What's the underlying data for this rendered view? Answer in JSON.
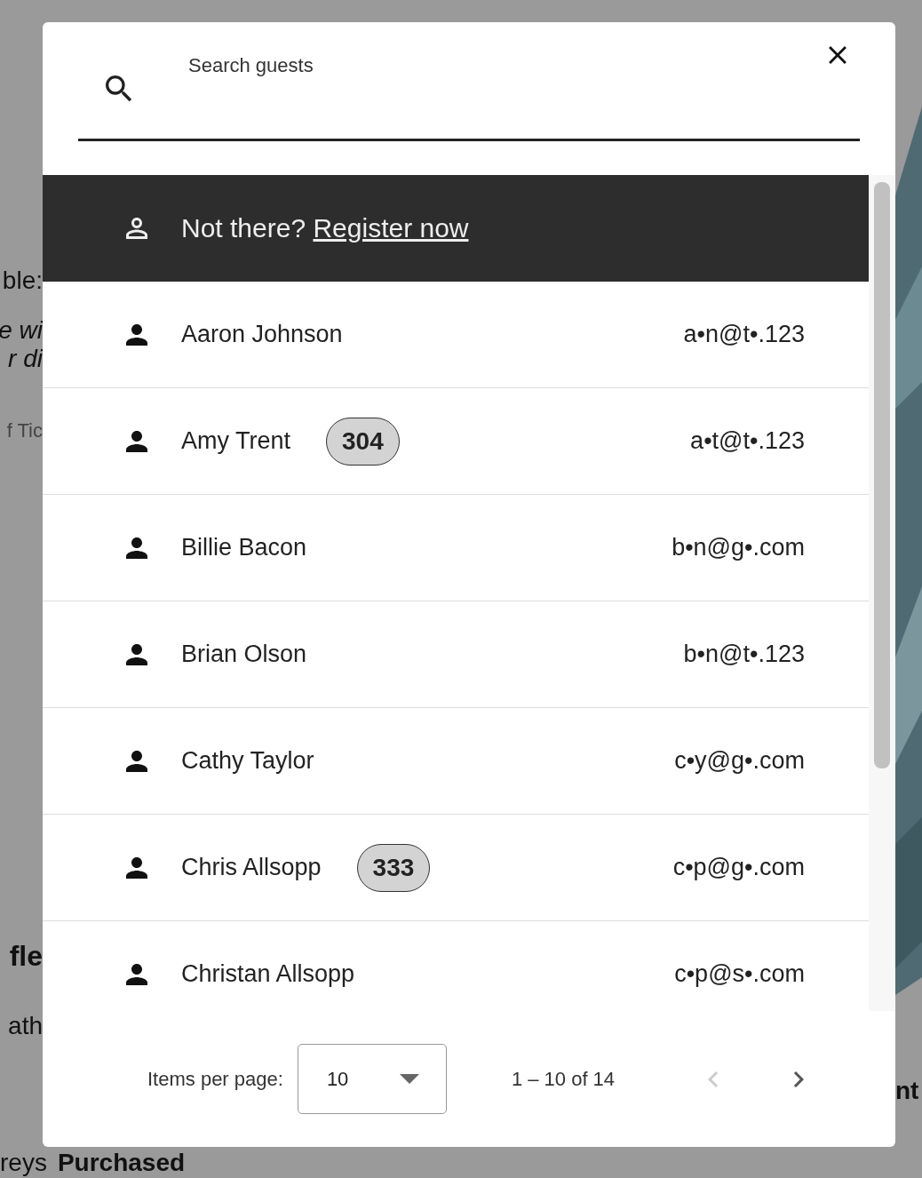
{
  "background": {
    "left_fragments": [
      "ble:",
      "e wi",
      "r di",
      "f Tic",
      "fle",
      "ath"
    ],
    "bottom_fragments": [
      "reys",
      "Purchased"
    ],
    "right_fragments": [
      "nt"
    ]
  },
  "dialog": {
    "search": {
      "label": "Search guests"
    },
    "register": {
      "text": "Not there?",
      "link": "Register now"
    },
    "guests": [
      {
        "name": "Aaron Johnson",
        "email": "a•n@t•.123"
      },
      {
        "name": "Amy Trent",
        "badge": "304",
        "email": "a•t@t•.123"
      },
      {
        "name": "Billie Bacon",
        "email": "b•n@g•.com"
      },
      {
        "name": "Brian Olson",
        "email": "b•n@t•.123"
      },
      {
        "name": "Cathy Taylor",
        "email": "c•y@g•.com"
      },
      {
        "name": "Chris Allsopp",
        "badge": "333",
        "email": "c•p@g•.com"
      },
      {
        "name": "Christan Allsopp",
        "email": "c•p@s•.com"
      }
    ],
    "paginator": {
      "label": "Items per page:",
      "page_size": "10",
      "range": "1 – 10 of 14",
      "prev_disabled": true,
      "next_disabled": false
    }
  }
}
